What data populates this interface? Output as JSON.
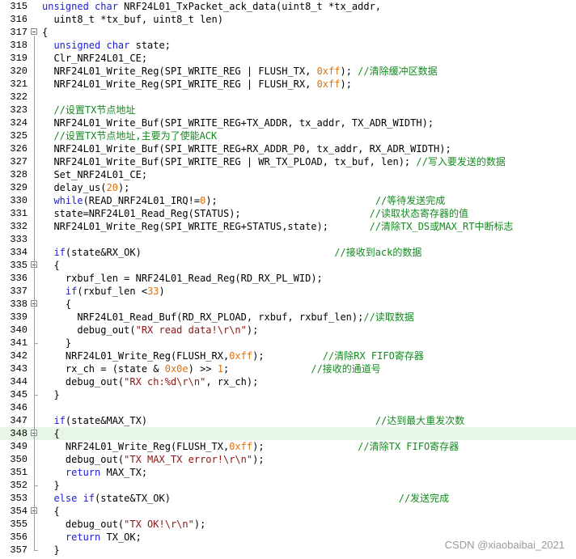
{
  "editor": {
    "lines": [
      {
        "n": "315",
        "parts": [
          [
            "kw",
            "unsigned char"
          ],
          [
            "t",
            " NRF24L01_TxPacket_ack_data(uint8_t *tx_addr,"
          ]
        ]
      },
      {
        "n": "316",
        "parts": [
          [
            "t",
            "  uint8_t *tx_buf, uint8_t len)"
          ]
        ]
      },
      {
        "n": "317",
        "fold": true,
        "parts": [
          [
            "t",
            "{"
          ]
        ]
      },
      {
        "n": "318",
        "parts": [
          [
            "t",
            "  "
          ],
          [
            "kw",
            "unsigned char"
          ],
          [
            "t",
            " state;"
          ]
        ]
      },
      {
        "n": "319",
        "parts": [
          [
            "t",
            "  Clr_NRF24L01_CE;"
          ]
        ]
      },
      {
        "n": "320",
        "parts": [
          [
            "t",
            "  NRF24L01_Write_Reg(SPI_WRITE_REG | FLUSH_TX, "
          ],
          [
            "num",
            "0xff"
          ],
          [
            "t",
            "); "
          ],
          [
            "cm",
            "//清除缓冲区数据"
          ]
        ]
      },
      {
        "n": "321",
        "parts": [
          [
            "t",
            "  NRF24L01_Write_Reg(SPI_WRITE_REG | FLUSH_RX, "
          ],
          [
            "num",
            "0xff"
          ],
          [
            "t",
            ");"
          ]
        ]
      },
      {
        "n": "322",
        "parts": []
      },
      {
        "n": "323",
        "parts": [
          [
            "t",
            "  "
          ],
          [
            "cm",
            "//设置TX节点地址"
          ]
        ]
      },
      {
        "n": "324",
        "parts": [
          [
            "t",
            "  NRF24L01_Write_Buf(SPI_WRITE_REG+TX_ADDR, tx_addr, TX_ADR_WIDTH);"
          ]
        ]
      },
      {
        "n": "325",
        "parts": [
          [
            "t",
            "  "
          ],
          [
            "cm",
            "//设置TX节点地址,主要为了使能ACK"
          ]
        ]
      },
      {
        "n": "326",
        "parts": [
          [
            "t",
            "  NRF24L01_Write_Buf(SPI_WRITE_REG+RX_ADDR_P0, tx_addr, RX_ADR_WIDTH);"
          ]
        ]
      },
      {
        "n": "327",
        "parts": [
          [
            "t",
            "  NRF24L01_Write_Buf(SPI_WRITE_REG | WR_TX_PLOAD, tx_buf, len); "
          ],
          [
            "cm",
            "//写入要发送的数据"
          ]
        ]
      },
      {
        "n": "328",
        "parts": [
          [
            "t",
            "  Set_NRF24L01_CE;"
          ]
        ]
      },
      {
        "n": "329",
        "parts": [
          [
            "t",
            "  delay_us("
          ],
          [
            "num",
            "20"
          ],
          [
            "t",
            ");"
          ]
        ]
      },
      {
        "n": "330",
        "parts": [
          [
            "t",
            "  "
          ],
          [
            "kw",
            "while"
          ],
          [
            "t",
            "(READ_NRF24L01_IRQ!="
          ],
          [
            "num",
            "0"
          ],
          [
            "t",
            ");                           "
          ],
          [
            "cm",
            "//等待发送完成"
          ]
        ]
      },
      {
        "n": "331",
        "parts": [
          [
            "t",
            "  state=NRF24L01_Read_Reg(STATUS);                      "
          ],
          [
            "cm",
            "//读取状态寄存器的值"
          ]
        ]
      },
      {
        "n": "332",
        "parts": [
          [
            "t",
            "  NRF24L01_Write_Reg(SPI_WRITE_REG+STATUS,state);       "
          ],
          [
            "cm",
            "//清除TX_DS或MAX_RT中断标志"
          ]
        ]
      },
      {
        "n": "333",
        "parts": []
      },
      {
        "n": "334",
        "parts": [
          [
            "t",
            "  "
          ],
          [
            "kw",
            "if"
          ],
          [
            "t",
            "(state&RX_OK)                                 "
          ],
          [
            "cm",
            "//接收到ack的数据"
          ]
        ]
      },
      {
        "n": "335",
        "fold": true,
        "parts": [
          [
            "t",
            "  {"
          ]
        ]
      },
      {
        "n": "336",
        "parts": [
          [
            "t",
            "    rxbuf_len = NRF24L01_Read_Reg(RD_RX_PL_WID);"
          ]
        ]
      },
      {
        "n": "337",
        "parts": [
          [
            "t",
            "    "
          ],
          [
            "kw",
            "if"
          ],
          [
            "t",
            "(rxbuf_len <"
          ],
          [
            "num",
            "33"
          ],
          [
            "t",
            ")"
          ]
        ]
      },
      {
        "n": "338",
        "fold": true,
        "parts": [
          [
            "t",
            "    {"
          ]
        ]
      },
      {
        "n": "339",
        "parts": [
          [
            "t",
            "      NRF24L01_Read_Buf(RD_RX_PLOAD, rxbuf, rxbuf_len);"
          ],
          [
            "cm",
            "//读取数据"
          ]
        ]
      },
      {
        "n": "340",
        "parts": [
          [
            "t",
            "      debug_out("
          ],
          [
            "str",
            "\"RX read data!\\r\\n\""
          ],
          [
            "t",
            ");"
          ]
        ]
      },
      {
        "n": "341",
        "parts": [
          [
            "t",
            "    }"
          ]
        ]
      },
      {
        "n": "342",
        "parts": [
          [
            "t",
            "    NRF24L01_Write_Reg(FLUSH_RX,"
          ],
          [
            "num",
            "0xff"
          ],
          [
            "t",
            ");          "
          ],
          [
            "cm",
            "//清除RX FIFO寄存器"
          ]
        ]
      },
      {
        "n": "343",
        "parts": [
          [
            "t",
            "    rx_ch = (state & "
          ],
          [
            "num",
            "0x0e"
          ],
          [
            "t",
            ") >> "
          ],
          [
            "num",
            "1"
          ],
          [
            "t",
            ";              "
          ],
          [
            "cm",
            "//接收的通道号"
          ]
        ]
      },
      {
        "n": "344",
        "parts": [
          [
            "t",
            "    debug_out("
          ],
          [
            "str",
            "\"RX ch:%d\\r\\n\""
          ],
          [
            "t",
            ", rx_ch);"
          ]
        ]
      },
      {
        "n": "345",
        "parts": [
          [
            "t",
            "  }"
          ]
        ]
      },
      {
        "n": "346",
        "parts": []
      },
      {
        "n": "347",
        "parts": [
          [
            "t",
            "  "
          ],
          [
            "kw",
            "if"
          ],
          [
            "t",
            "(state&MAX_TX)                                       "
          ],
          [
            "cm",
            "//达到最大重发次数"
          ]
        ]
      },
      {
        "n": "348",
        "fold": true,
        "hl": true,
        "parts": [
          [
            "t",
            "  {"
          ]
        ]
      },
      {
        "n": "349",
        "parts": [
          [
            "t",
            "    NRF24L01_Write_Reg(FLUSH_TX,"
          ],
          [
            "num",
            "0xff"
          ],
          [
            "t",
            ");                "
          ],
          [
            "cm",
            "//清除TX FIFO寄存器"
          ]
        ]
      },
      {
        "n": "350",
        "parts": [
          [
            "t",
            "    debug_out("
          ],
          [
            "str",
            "\"TX MAX_TX error!\\r\\n\""
          ],
          [
            "t",
            ");"
          ]
        ]
      },
      {
        "n": "351",
        "parts": [
          [
            "t",
            "    "
          ],
          [
            "kw",
            "return"
          ],
          [
            "t",
            " MAX_TX;"
          ]
        ]
      },
      {
        "n": "352",
        "parts": [
          [
            "t",
            "  }"
          ]
        ]
      },
      {
        "n": "353",
        "parts": [
          [
            "t",
            "  "
          ],
          [
            "kw",
            "else if"
          ],
          [
            "t",
            "(state&TX_OK)                                       "
          ],
          [
            "cm",
            "//发送完成"
          ]
        ]
      },
      {
        "n": "354",
        "fold": true,
        "parts": [
          [
            "t",
            "  {"
          ]
        ]
      },
      {
        "n": "355",
        "parts": [
          [
            "t",
            "    debug_out("
          ],
          [
            "str",
            "\"TX OK!\\r\\n\""
          ],
          [
            "t",
            ");"
          ]
        ]
      },
      {
        "n": "356",
        "parts": [
          [
            "t",
            "    "
          ],
          [
            "kw",
            "return"
          ],
          [
            "t",
            " TX_OK;"
          ]
        ]
      },
      {
        "n": "357",
        "parts": [
          [
            "t",
            "  }"
          ]
        ]
      }
    ]
  },
  "watermark": "CSDN @xiaobaibai_2021",
  "colors": {
    "keyword": "#1c1cd6",
    "number": "#e0700a",
    "string": "#8a1515",
    "comment": "#128a1e",
    "highlight": "#e8f6e8"
  },
  "icons": {
    "fold": "fold-minus-icon"
  }
}
